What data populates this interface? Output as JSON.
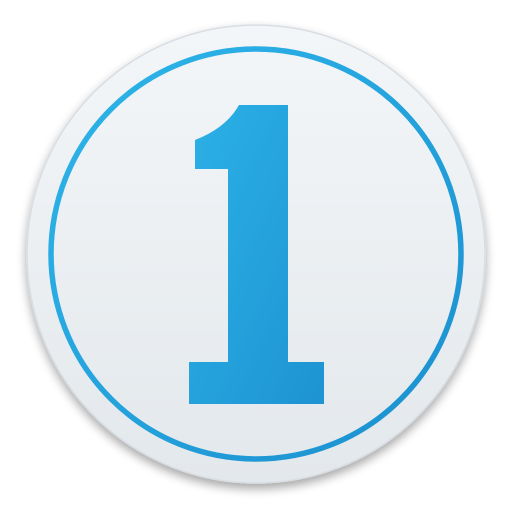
{
  "icon": {
    "name": "capture-one-app-icon",
    "glyph": "1",
    "colors": {
      "disc_light": "#f3f6f8",
      "disc_dark": "#e3e8ec",
      "disc_edge": "#d7dde2",
      "ring_light": "#2eb6ea",
      "ring_dark": "#1b8fcf",
      "glyph_light": "#2bb1e6",
      "glyph_dark": "#1e93d2"
    }
  }
}
